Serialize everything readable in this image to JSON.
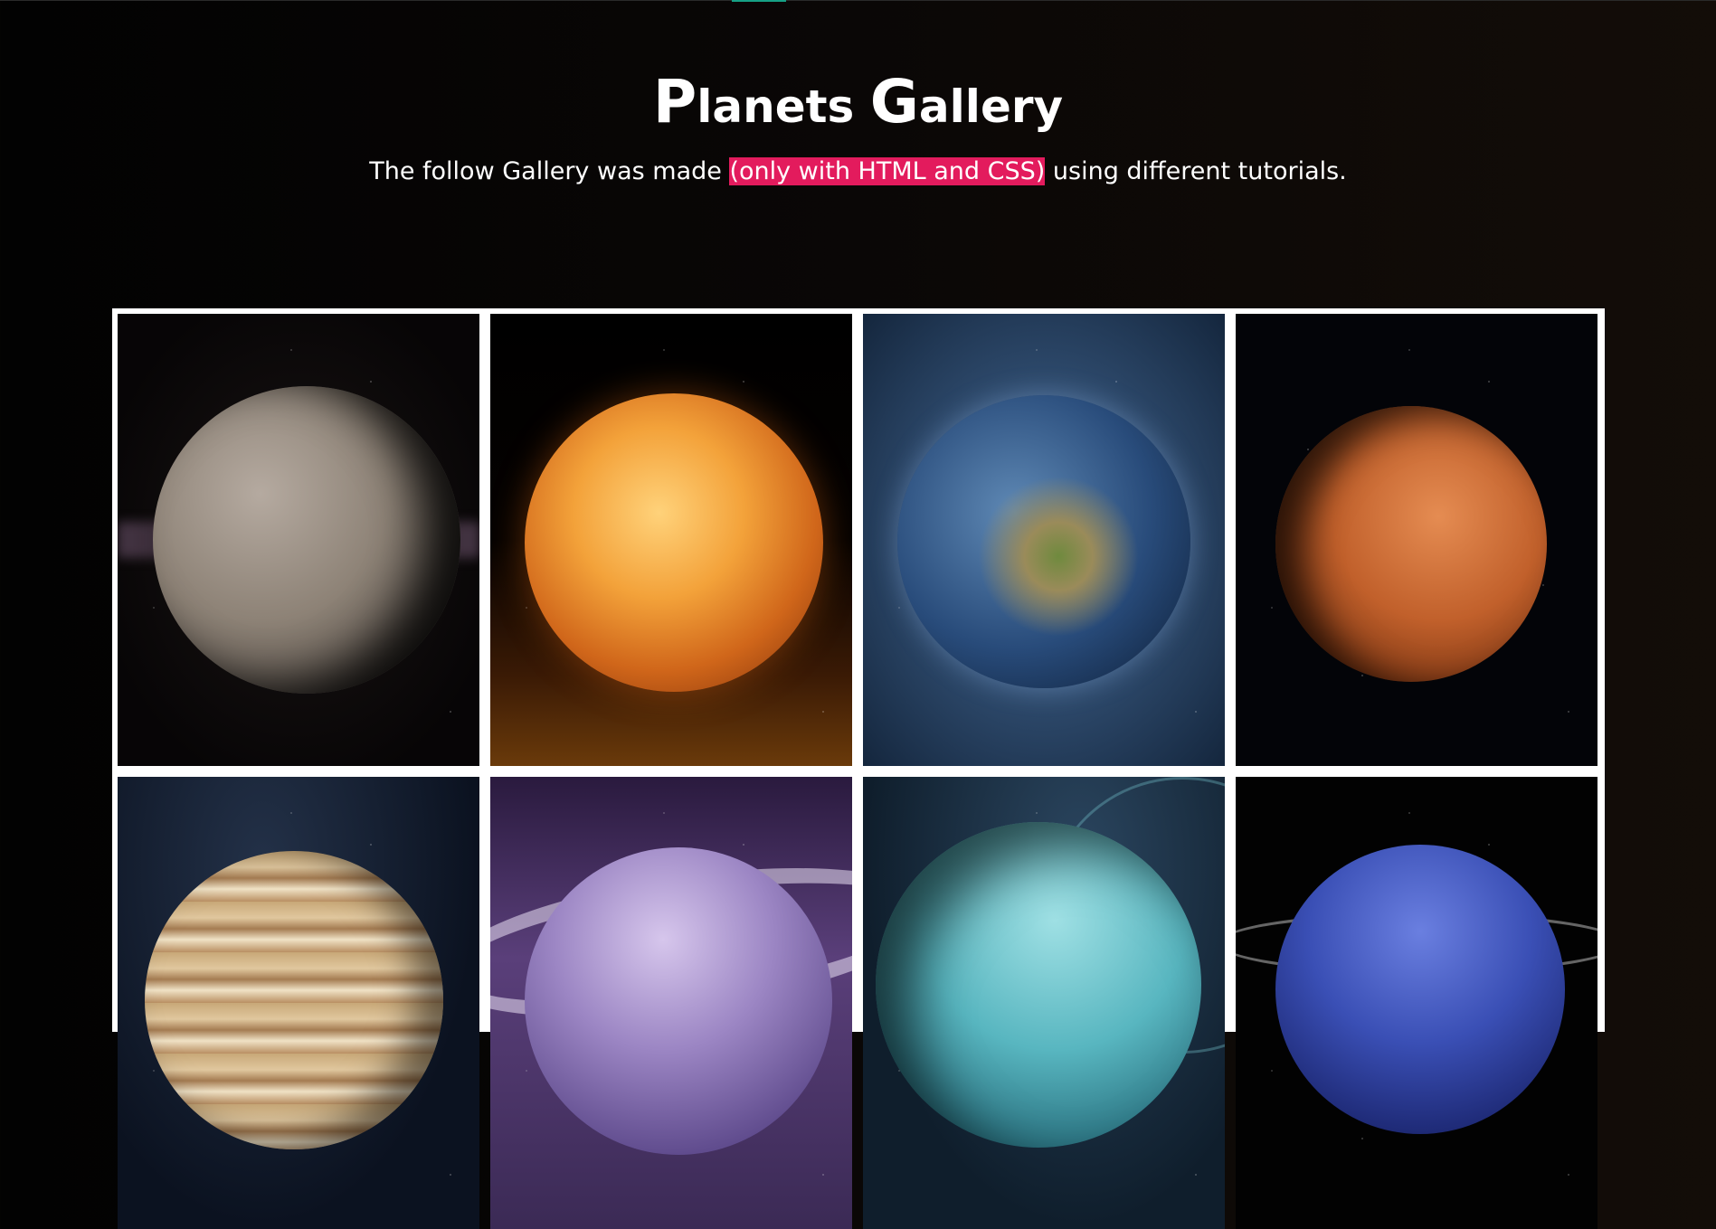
{
  "header": {
    "title_cap_1": "P",
    "title_rest_1": "lanets",
    "title_cap_2": "G",
    "title_rest_2": "allery",
    "subtitle_before": "The follow Gallery was made ",
    "subtitle_highlight": "(only with HTML and CSS)",
    "subtitle_after": " using different tutorials."
  },
  "colors": {
    "highlight": "#e31b5d",
    "top_accent": "#16a085",
    "gallery_frame": "#ffffff"
  },
  "gallery": {
    "images": [
      {
        "name": "mercury"
      },
      {
        "name": "venus"
      },
      {
        "name": "earth"
      },
      {
        "name": "mars"
      },
      {
        "name": "jupiter"
      },
      {
        "name": "saturn"
      },
      {
        "name": "uranus"
      },
      {
        "name": "neptune"
      }
    ]
  }
}
